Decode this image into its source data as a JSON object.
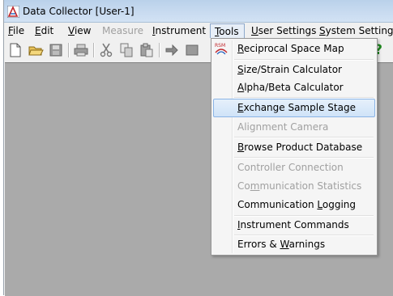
{
  "window": {
    "title": "Data Collector [User-1]"
  },
  "menubar": [
    {
      "label": "File",
      "mnemonic": "F",
      "rest": "ile",
      "enabled": true
    },
    {
      "label": "Edit",
      "mnemonic": "E",
      "rest": "dit",
      "enabled": true
    },
    {
      "label": "View",
      "mnemonic": "V",
      "rest": "iew",
      "enabled": true
    },
    {
      "label": "Measure",
      "mnemonic": "",
      "rest": "Measure",
      "enabled": false
    },
    {
      "label": "Instrument",
      "mnemonic": "I",
      "rest": "nstrument",
      "enabled": true
    },
    {
      "label": "Tools",
      "mnemonic": "T",
      "rest": "ools",
      "enabled": true,
      "open": true
    },
    {
      "label": "User Settings",
      "mnemonic": "U",
      "rest": "ser Settings",
      "enabled": true
    },
    {
      "label": "System Settings",
      "mnemonic": "S",
      "rest": "ystem Settings",
      "enabled": true
    }
  ],
  "toolbar": {
    "buttons": [
      "new-document-icon",
      "open-folder-icon",
      "save-icon",
      "print-icon",
      "cut-icon",
      "copy-icon",
      "paste-icon",
      "arrow-right-icon",
      "help-icon"
    ],
    "help_glyph": "?"
  },
  "tools_menu": {
    "icon_label": "RSM",
    "items": [
      {
        "pre": "",
        "mn": "R",
        "post": "eciprocal Space Map",
        "enabled": true
      },
      {
        "pre": "",
        "mn": "S",
        "post": "ize/Strain Calculator",
        "enabled": true
      },
      {
        "pre": "",
        "mn": "A",
        "post": "lpha/Beta Calculator",
        "enabled": true
      },
      {
        "pre": "",
        "mn": "E",
        "post": "xchange Sample Stage",
        "enabled": true,
        "highlighted": true
      },
      {
        "pre": "Alignment Camera",
        "mn": "",
        "post": "",
        "enabled": false
      },
      {
        "pre": "",
        "mn": "B",
        "post": "rowse Product Database",
        "enabled": true
      },
      {
        "pre": "Controller Connection",
        "mn": "",
        "post": "",
        "enabled": false
      },
      {
        "pre": "Co",
        "mn": "m",
        "post": "munication Statistics",
        "enabled": false
      },
      {
        "pre": "Communication ",
        "mn": "L",
        "post": "ogging",
        "enabled": true
      },
      {
        "pre": "",
        "mn": "I",
        "post": "nstrument Commands",
        "enabled": true
      },
      {
        "pre": "Errors & ",
        "mn": "W",
        "post": "arnings",
        "enabled": true
      }
    ]
  },
  "colors": {
    "client_bg": "#aaaaaa",
    "menu_bg": "#f5f5f5",
    "highlight": "#cfe3f8",
    "disabled_text": "#a0a0a0"
  }
}
